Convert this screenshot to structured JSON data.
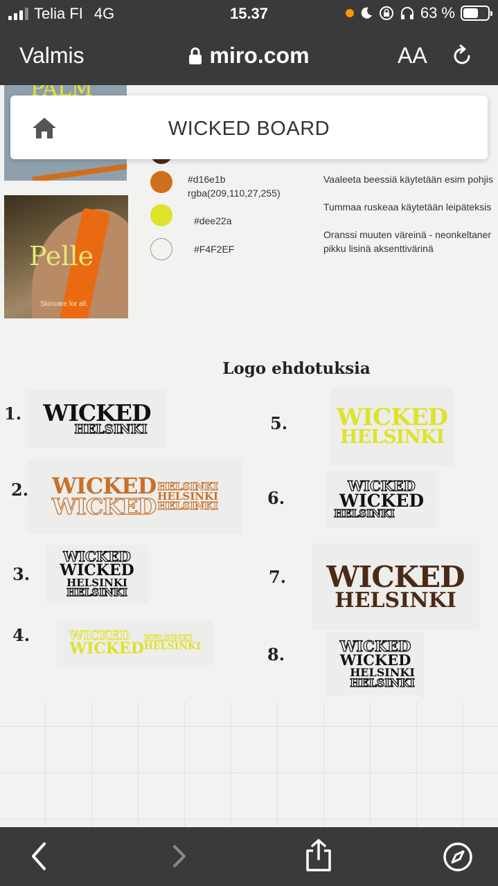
{
  "status_bar": {
    "carrier": "Telia FI",
    "network": "4G",
    "time": "15.37",
    "battery": "63 %",
    "battery_level": 0.63,
    "icons": [
      "orange-dot-icon",
      "moon-icon",
      "rotation-lock-icon",
      "headphones-icon",
      "battery-icon"
    ]
  },
  "browser": {
    "done_label": "Valmis",
    "url": "miro.com",
    "text_size_label": "AA",
    "icons": [
      "lock-icon",
      "reload-icon"
    ]
  },
  "board": {
    "title": "WICKED BOARD",
    "home_icon": "home-icon"
  },
  "moodboard": {
    "thumb1_text": "PALM",
    "thumb2_title": "Pelle",
    "thumb2_tagline": "Skincare for all."
  },
  "palette": [
    {
      "hex": "#d16e1b",
      "rgba": "rgba(209,110,27,255)",
      "color": "#d16e1b"
    },
    {
      "hex": "#dee22a",
      "color": "#dee22a"
    },
    {
      "hex": "#F4F2EF",
      "color": "#F4F2EF"
    }
  ],
  "palette_descriptions": [
    "Vaaleeta beessiä käytetään esim pohjis",
    "Tummaa ruskeaa käytetään leipäteksis",
    "Oranssi muuten väreinä - neonkeltaner",
    "pikku lisinä aksenttivärinä"
  ],
  "logos": {
    "title": "Logo ehdotuksia",
    "wicked": "WICKED",
    "helsinki": "HELSINKI",
    "numbers": [
      "1.",
      "2.",
      "3.",
      "4.",
      "5.",
      "6.",
      "7.",
      "8."
    ],
    "colors": {
      "orange": "#c8702a",
      "yellow": "#dee22a",
      "brown": "#4a2a16",
      "black": "#111111"
    }
  },
  "toolbar": {
    "icons": [
      "back-icon",
      "forward-icon",
      "share-icon",
      "compass-icon"
    ]
  }
}
